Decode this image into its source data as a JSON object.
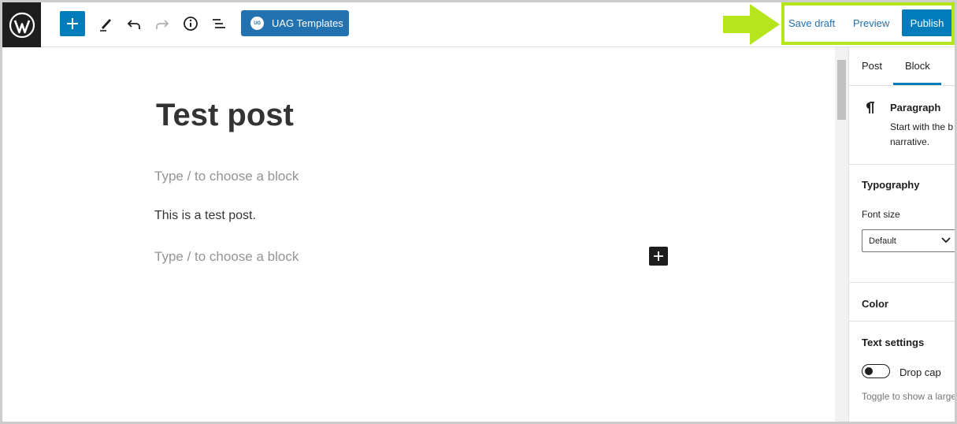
{
  "toolbar": {
    "uag_label": "UAG Templates",
    "uag_logo_text": "UG",
    "save_draft": "Save draft",
    "preview": "Preview",
    "publish": "Publish"
  },
  "editor": {
    "title": "Test post",
    "placeholder_1": "Type / to choose a block",
    "paragraph": "This is a test post.",
    "placeholder_2": "Type / to choose a block"
  },
  "sidebar": {
    "tabs": [
      {
        "label": "Post"
      },
      {
        "label": "Block"
      }
    ],
    "active_tab": "Block",
    "block_name": "Paragraph",
    "block_desc_line1": "Start with the b",
    "block_desc_line2": "narrative.",
    "typography_heading": "Typography",
    "font_size_label": "Font size",
    "font_size_value": "Default",
    "color_heading": "Color",
    "text_settings_heading": "Text settings",
    "drop_cap_label": "Drop cap",
    "drop_cap_help": "Toggle to show a large"
  },
  "colors": {
    "accent": "#007cba",
    "highlight": "#b5e51d"
  }
}
